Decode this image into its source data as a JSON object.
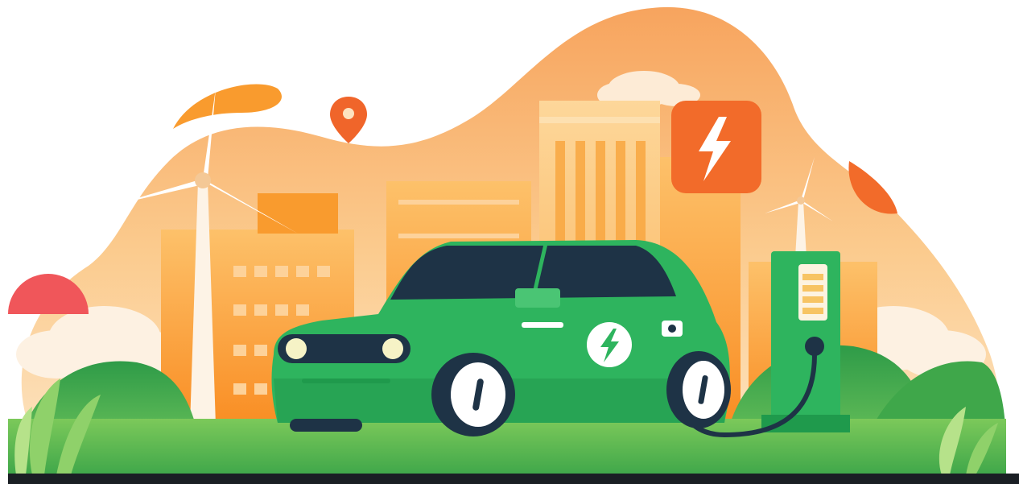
{
  "scene": {
    "subject": "ev-charging-illustration"
  },
  "colors": {
    "sky_peach": "#FBD3A6",
    "sky_orange": "#F7A45E",
    "building_orange": "#F99B2E",
    "building_light": "#FDC16A",
    "accent_orange": "#F26B2A",
    "pin_orange": "#F0652A",
    "car_green": "#2EB45E",
    "car_green_dark": "#1F9A4C",
    "window_navy": "#1E3346",
    "ground_green": "#4CB548",
    "hill_green": "#2E9B48",
    "turbine_white": "#FFFFFF",
    "ground_strip": "#1A1F24"
  },
  "icons": {
    "map_pin": "map-pin-icon",
    "lightning_badge": "lightning-badge-icon",
    "car_lightning": "car-lightning-icon"
  }
}
